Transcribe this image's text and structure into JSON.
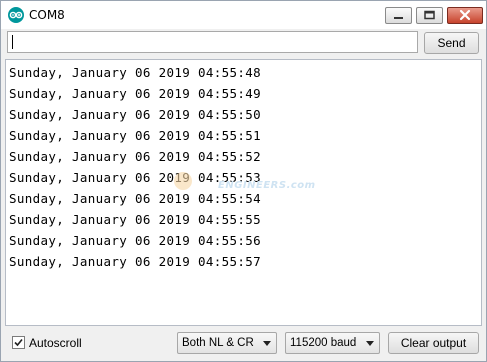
{
  "window": {
    "title": "COM8",
    "accent_color": "#00979c",
    "close_color": "#c7432c"
  },
  "input": {
    "value": "",
    "send_label": "Send"
  },
  "output": {
    "lines": [
      "Sunday, January 06 2019 04:55:48",
      "Sunday, January 06 2019 04:55:49",
      "Sunday, January 06 2019 04:55:50",
      "Sunday, January 06 2019 04:55:51",
      "Sunday, January 06 2019 04:55:52",
      "Sunday, January 06 2019 04:55:53",
      "Sunday, January 06 2019 04:55:54",
      "Sunday, January 06 2019 04:55:55",
      "Sunday, January 06 2019 04:55:56",
      "Sunday, January 06 2019 04:55:57"
    ],
    "watermark": "ENGINEERS.com"
  },
  "footer": {
    "autoscroll_label": "Autoscroll",
    "autoscroll_checked": true,
    "line_ending": "Both NL & CR",
    "baud_rate": "115200 baud",
    "clear_label": "Clear output"
  }
}
